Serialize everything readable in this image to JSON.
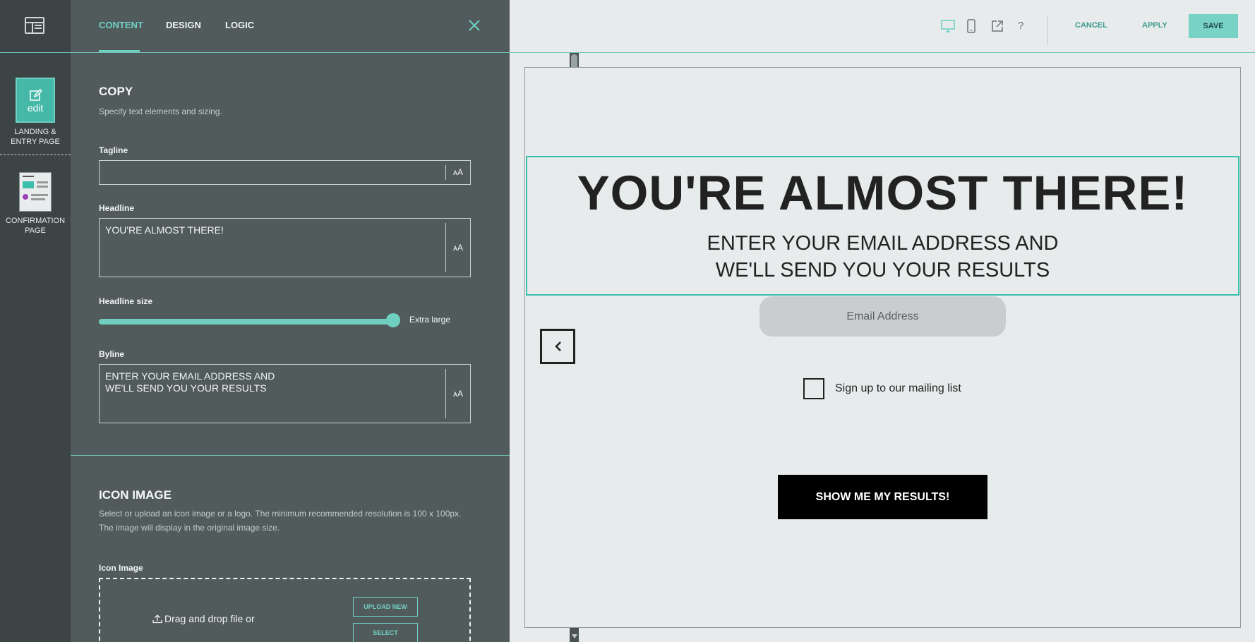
{
  "rail": {
    "pages": [
      {
        "thumb_text": "edit",
        "label": "LANDING &\nENTRY PAGE"
      },
      {
        "label": "CONFIRMATION\nPAGE"
      }
    ]
  },
  "panel": {
    "tabs": [
      "CONTENT",
      "DESIGN",
      "LOGIC"
    ],
    "copy": {
      "title": "COPY",
      "desc": "Specify text elements and sizing.",
      "tagline_label": "Tagline",
      "tagline_value": "",
      "headline_label": "Headline",
      "headline_value": "YOU'RE ALMOST THERE!",
      "headline_size_label": "Headline size",
      "headline_size_value": "Extra large",
      "headline_size_level": 1.0,
      "byline_label": "Byline",
      "byline_value": "ENTER YOUR EMAIL ADDRESS AND\nWE'LL SEND YOU YOUR RESULTS",
      "font_size_glyph": "ᴀA"
    },
    "icon_image": {
      "title": "ICON IMAGE",
      "desc": "Select or upload an icon image or a logo. The minimum recommended resolution is 100 x 100px.\nThe image will display in the original image size.",
      "field_label": "Icon Image",
      "drop_text": "Drag and drop file or",
      "upload_label": "UPLOAD NEW",
      "select_label": "SELECT"
    }
  },
  "toolbar": {
    "cancel": "CANCEL",
    "apply": "APPLY",
    "save": "SAVE",
    "help": "?"
  },
  "preview": {
    "headline": "YOU'RE ALMOST THERE!",
    "byline": "ENTER YOUR EMAIL ADDRESS AND\nWE'LL SEND YOU YOUR RESULTS",
    "email_placeholder": "Email Address",
    "checkbox_label": "Sign up to our mailing list",
    "cta": "SHOW ME MY RESULTS!"
  },
  "colors": {
    "accent": "#6fd0c2",
    "rail_bg": "#3c4445",
    "panel_bg": "#525b5c",
    "preview_bg": "#e7ebec",
    "selection_border": "#3bbfab"
  }
}
